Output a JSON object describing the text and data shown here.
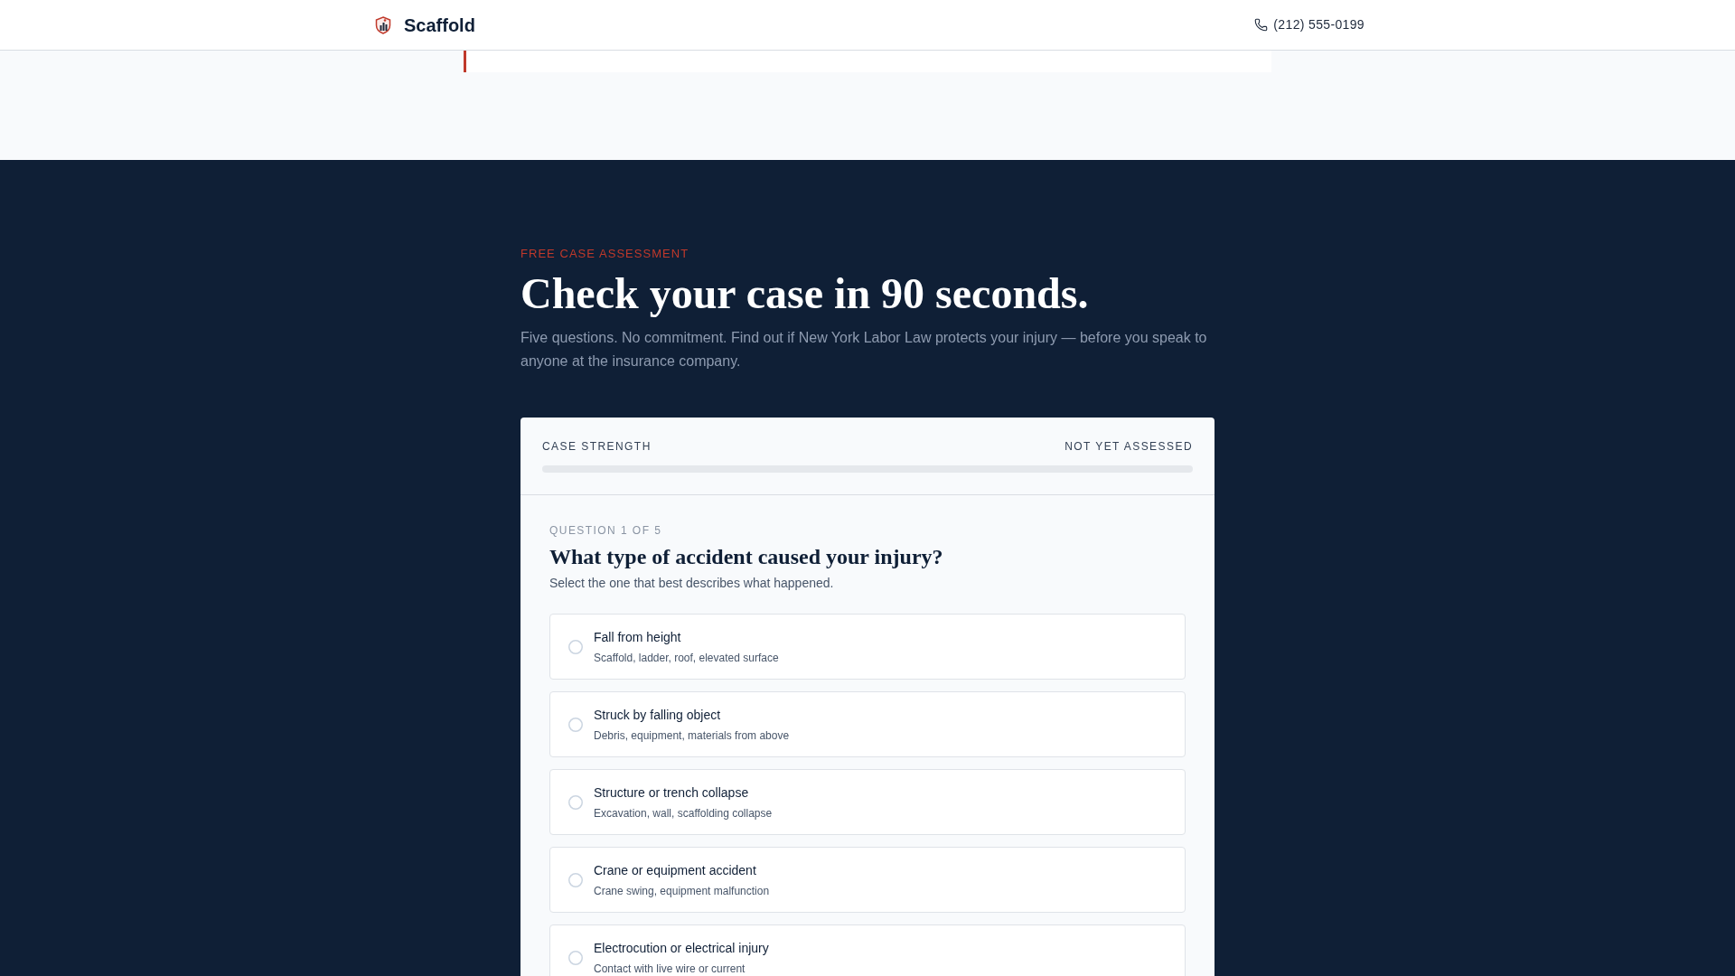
{
  "header": {
    "brand": "Scaffold",
    "phone": "(212) 555-0199"
  },
  "hero": {
    "eyebrow": "FREE CASE ASSESSMENT",
    "title": "Check your case in 90 seconds.",
    "subtitle": "Five questions. No commitment. Find out if New York Labor Law protects your injury — before you speak to anyone at the insurance company."
  },
  "strength": {
    "label": "CASE STRENGTH",
    "status": "NOT YET ASSESSED",
    "level": 0
  },
  "question": {
    "counter": "QUESTION 1 OF 5",
    "title": "What type of accident caused your injury?",
    "hint": "Select the one that best describes what happened.",
    "options": [
      {
        "label": "Fall from height",
        "description": "Scaffold, ladder, roof, elevated surface",
        "selected": false
      },
      {
        "label": "Struck by falling object",
        "description": "Debris, equipment, materials from above",
        "selected": false
      },
      {
        "label": "Structure or trench collapse",
        "description": "Excavation, wall, scaffolding collapse",
        "selected": false
      },
      {
        "label": "Crane or equipment accident",
        "description": "Crane swing, equipment malfunction",
        "selected": false
      },
      {
        "label": "Electrocution or electrical injury",
        "description": "Contact with live wire or current",
        "selected": false
      }
    ]
  }
}
